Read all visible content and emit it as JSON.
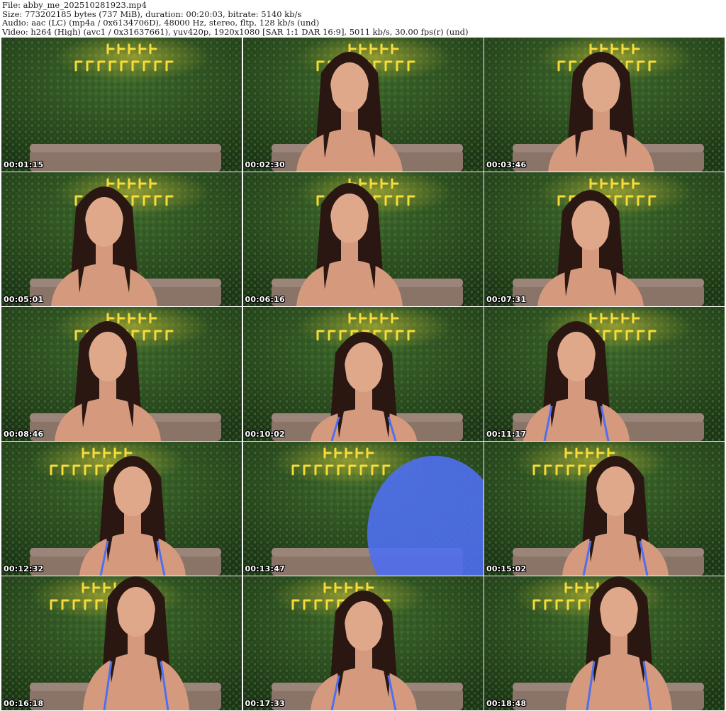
{
  "header": {
    "line1": "File: abby_me_202510281923.mp4",
    "line2": "Size: 773202185 bytes (737 MiB), duration: 00:20:03, bitrate: 5140 kb/s",
    "line3": "Audio: aac (LC) (mp4a / 0x6134706D), 48000 Hz, stereo, fltp, 128 kb/s (und)",
    "line4": "Video: h264 (High) (avc1 / 0x31637661), yuv420p, 1920x1080 [SAR 1:1 DAR 16:9], 5011 kb/s, 30.00 fps(r) (und)"
  },
  "frames": [
    {
      "time": "00:01:15"
    },
    {
      "time": "00:02:30"
    },
    {
      "time": "00:03:46"
    },
    {
      "time": "00:05:01"
    },
    {
      "time": "00:06:16"
    },
    {
      "time": "00:07:31"
    },
    {
      "time": "00:08:46"
    },
    {
      "time": "00:10:02"
    },
    {
      "time": "00:11:17"
    },
    {
      "time": "00:12:32"
    },
    {
      "time": "00:13:47"
    },
    {
      "time": "00:15:02"
    },
    {
      "time": "00:16:18"
    },
    {
      "time": "00:17:33"
    },
    {
      "time": "00:18:48"
    }
  ],
  "colors": {
    "hedge_dark": "#1c3417",
    "hedge_light": "#3f6a2c",
    "neon": "#ffe23a",
    "couch": "#8a7468",
    "skin": "#d59a7e",
    "hair": "#2a1712",
    "bikini": "#4f6ff0"
  }
}
